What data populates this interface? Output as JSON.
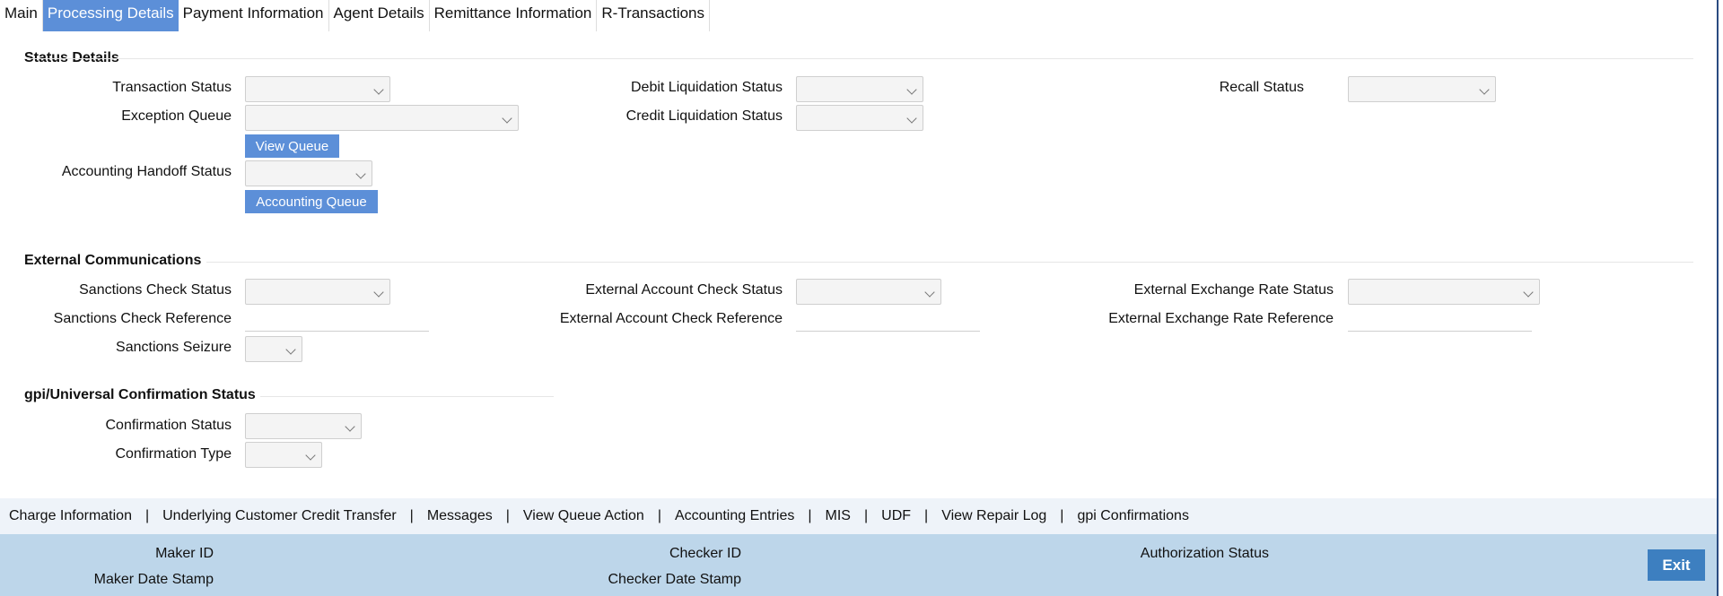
{
  "tabs": [
    "Main",
    "Processing Details",
    "Payment Information",
    "Agent Details",
    "Remittance Information",
    "R-Transactions"
  ],
  "status_details": {
    "title": "Status Details",
    "transaction_status": "Transaction Status",
    "exception_queue": "Exception Queue",
    "view_queue_button": "View Queue",
    "accounting_handoff_status": "Accounting Handoff Status",
    "accounting_queue_button": "Accounting Queue",
    "debit_liquidation_status": "Debit Liquidation Status",
    "credit_liquidation_status": "Credit Liquidation Status",
    "recall_status": "Recall Status"
  },
  "external_communications": {
    "title": "External Communications",
    "sanctions_check_status": "Sanctions Check Status",
    "sanctions_check_reference": "Sanctions Check Reference",
    "sanctions_seizure": "Sanctions Seizure",
    "external_account_check_status": "External Account Check Status",
    "external_account_check_reference": "External Account Check Reference",
    "external_exchange_rate_status": "External Exchange Rate Status",
    "external_exchange_rate_reference": "External Exchange Rate Reference"
  },
  "gpi": {
    "title": "gpi/Universal Confirmation Status",
    "confirmation_status": "Confirmation Status",
    "confirmation_type": "Confirmation Type"
  },
  "links": [
    "Charge Information",
    "Underlying Customer Credit Transfer",
    "Messages",
    "View Queue Action",
    "Accounting Entries",
    "MIS",
    "UDF",
    "View Repair Log",
    "gpi Confirmations"
  ],
  "footer": {
    "maker_id": "Maker ID",
    "maker_date_stamp": "Maker Date Stamp",
    "checker_id": "Checker ID",
    "checker_date_stamp": "Checker Date Stamp",
    "authorization_status": "Authorization Status",
    "exit_label": "Exit"
  }
}
